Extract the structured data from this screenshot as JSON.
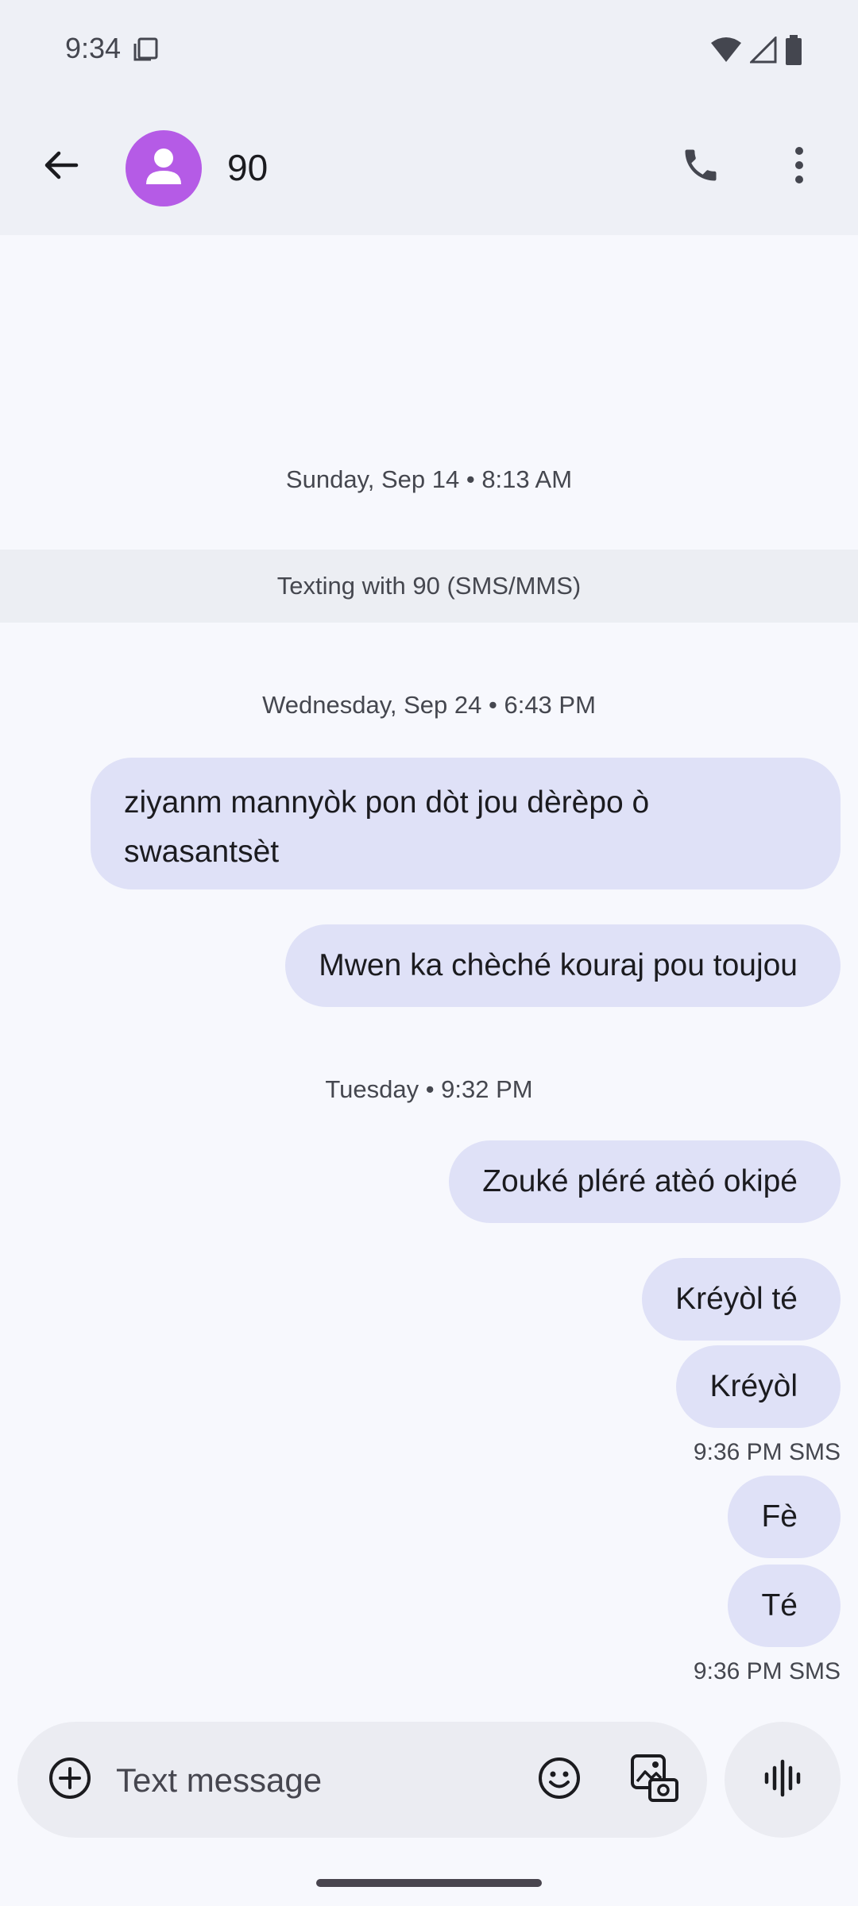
{
  "status_bar": {
    "time": "9:34"
  },
  "header": {
    "contact_name": "90"
  },
  "conversation": {
    "timestamp_1": "Sunday, Sep 14 • 8:13 AM",
    "banner": "Texting with 90 (SMS/MMS)",
    "timestamp_2": "Wednesday, Sep 24 • 6:43 PM",
    "timestamp_3": "Tuesday • 9:32 PM",
    "messages": [
      {
        "text": "ziyanm mannyòk pon dòt jou dèrèpo ò swasantsèt"
      },
      {
        "text": "Mwen ka chèché kouraj pou toujou"
      },
      {
        "text": "Zouké pléré atèó okipé"
      },
      {
        "text": "Kréyòl té"
      },
      {
        "text": "Kréyòl"
      },
      {
        "text": "Fè"
      },
      {
        "text": "Té"
      }
    ],
    "meta_1": "9:36 PM  SMS",
    "meta_2": "9:36 PM  SMS"
  },
  "composer": {
    "placeholder": "Text message"
  },
  "colors": {
    "avatar": "#b55be6",
    "sent_bubble": "#dfe1f7",
    "background": "#f7f8fd"
  }
}
